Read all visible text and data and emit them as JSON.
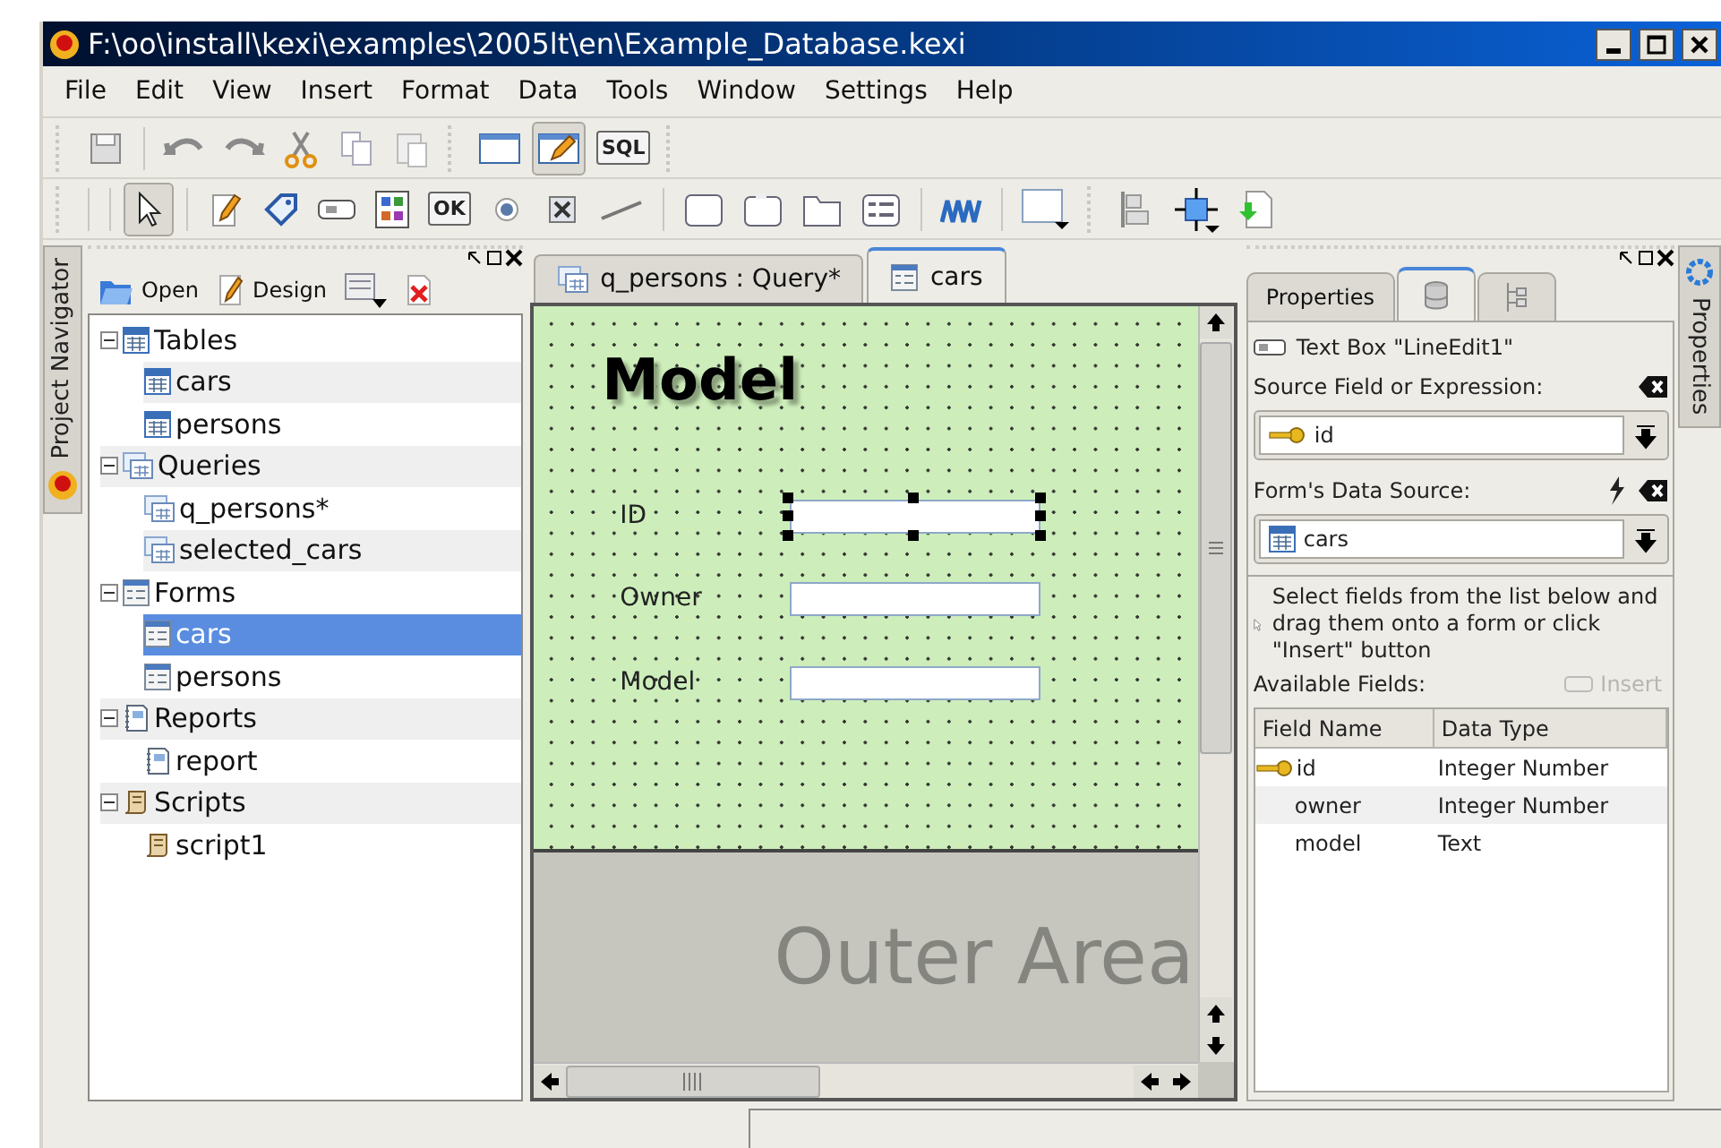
{
  "window": {
    "title": "F:\\oo\\install\\kexi\\examples\\2005lt\\en\\Example_Database.kexi"
  },
  "menu": [
    {
      "label": "File"
    },
    {
      "label": "Edit"
    },
    {
      "label": "View"
    },
    {
      "label": "Insert"
    },
    {
      "label": "Format"
    },
    {
      "label": "Data"
    },
    {
      "label": "Tools"
    },
    {
      "label": "Window"
    },
    {
      "label": "Settings"
    },
    {
      "label": "Help"
    }
  ],
  "view_buttons": [
    {
      "selected": false
    },
    {
      "selected": true
    },
    {
      "label": "SQL",
      "selected": false
    }
  ],
  "widget_tools": [
    {
      "selected": true
    },
    {
      "selected": false
    },
    {
      "selected": false
    },
    {
      "selected": false
    },
    {
      "selected": false
    },
    {
      "label": "OK",
      "selected": false
    },
    {
      "selected": false
    },
    {
      "selected": false
    },
    {
      "selected": false
    }
  ],
  "left_dock_tab": {
    "label": "Project Navigator"
  },
  "navigator": {
    "toolbar": [
      {
        "label": "Open"
      },
      {
        "label": "Design"
      }
    ],
    "tree": [
      {
        "label": "Tables",
        "kind": "table",
        "selected": false,
        "expanded": true,
        "children": [
          {
            "label": "cars",
            "kind": "table",
            "selected": false
          },
          {
            "label": "persons",
            "kind": "table",
            "selected": false
          }
        ]
      },
      {
        "label": "Queries",
        "kind": "query",
        "selected": false,
        "expanded": true,
        "children": [
          {
            "label": "q_persons*",
            "kind": "query",
            "selected": false
          },
          {
            "label": "selected_cars",
            "kind": "query",
            "selected": false
          }
        ]
      },
      {
        "label": "Forms",
        "kind": "form",
        "selected": false,
        "expanded": true,
        "children": [
          {
            "label": "cars",
            "kind": "form",
            "selected": true
          },
          {
            "label": "persons",
            "kind": "form",
            "selected": false
          }
        ]
      },
      {
        "label": "Reports",
        "kind": "report",
        "selected": false,
        "expanded": true,
        "children": [
          {
            "label": "report",
            "kind": "report",
            "selected": false
          }
        ]
      },
      {
        "label": "Scripts",
        "kind": "script",
        "selected": false,
        "expanded": true,
        "children": [
          {
            "label": "script1",
            "kind": "script",
            "selected": false
          }
        ]
      }
    ]
  },
  "doc_tabs": [
    {
      "label": "q_persons : Query*",
      "kind": "query",
      "selected": false
    },
    {
      "label": "cars",
      "kind": "form",
      "selected": true
    }
  ],
  "form": {
    "title": "Model",
    "fields": [
      {
        "label": "ID",
        "selected": true
      },
      {
        "label": "Owner",
        "selected": false
      },
      {
        "label": "Model",
        "selected": false
      }
    ],
    "outer_area": "Outer Area"
  },
  "property_tabs": [
    {
      "label": "Properties",
      "selected": false
    },
    {
      "kind": "datasource",
      "selected": true
    },
    {
      "kind": "tree",
      "selected": false
    }
  ],
  "data_source": {
    "widget": "Text Box \"LineEdit1\"",
    "source_label": "Source Field or Expression:",
    "source_value": "id",
    "form_source_label": "Form's Data Source:",
    "form_source_value": "cars",
    "hint": "Select fields from the list below and drag them onto a form or click \"Insert\" button",
    "available_label": "Available Fields:",
    "insert_button": {
      "label": "Insert",
      "disabled": true
    },
    "columns": [
      "Field Name",
      "Data Type"
    ],
    "rows": [
      {
        "name": "id",
        "type": "Integer Number",
        "primary_key": true
      },
      {
        "name": "owner",
        "type": "Integer Number",
        "primary_key": false
      },
      {
        "name": "model",
        "type": "Text",
        "primary_key": false
      }
    ]
  },
  "right_dock_tab": {
    "label": "Properties"
  }
}
